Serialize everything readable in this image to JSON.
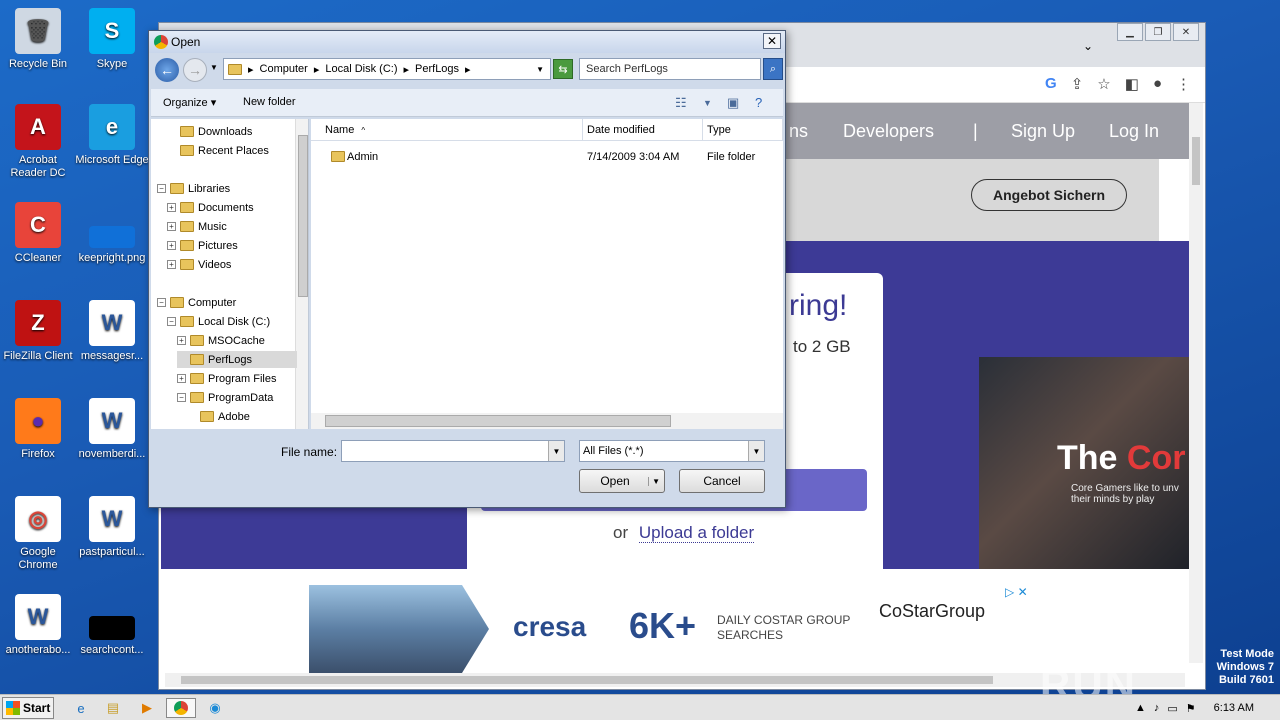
{
  "desktop_icons": [
    {
      "label": "Recycle Bin",
      "icon": "recycle-bin-icon"
    },
    {
      "label": "Skype",
      "icon": "skype-icon"
    },
    {
      "label": "Acrobat Reader DC",
      "icon": "acrobat-icon"
    },
    {
      "label": "Microsoft Edge",
      "icon": "edge-icon"
    },
    {
      "label": "CCleaner",
      "icon": "ccleaner-icon"
    },
    {
      "label": "keepright.png",
      "icon": "image-file-icon"
    },
    {
      "label": "FileZilla Client",
      "icon": "filezilla-icon"
    },
    {
      "label": "messagesr...",
      "icon": "word-doc-icon"
    },
    {
      "label": "Firefox",
      "icon": "firefox-icon"
    },
    {
      "label": "novemberdi...",
      "icon": "word-doc-icon"
    },
    {
      "label": "Google Chrome",
      "icon": "chrome-icon"
    },
    {
      "label": "pastparticul...",
      "icon": "word-doc-icon"
    },
    {
      "label": "anotherabo...",
      "icon": "word-doc-icon"
    },
    {
      "label": "searchcont...",
      "icon": "black-file-icon"
    }
  ],
  "browser": {
    "nav": [
      "ns",
      "Developers",
      "|",
      "Sign Up",
      "Log In"
    ],
    "angebot_button": "Angebot Sichern",
    "card_title": "ring!",
    "card_sub": "to 2 GB",
    "or_text": "or",
    "upload_folder": "Upload a folder",
    "promo_title_white": "The ",
    "promo_title_red": "Cor",
    "promo_sub": "Core Gamers like to unv their minds by play",
    "ad": {
      "brand": "cresa",
      "big": "6K+",
      "line1": "DAILY COSTAR GROUP",
      "line2": "SEARCHES",
      "costar": "CoStarGroup",
      "close": "▷ ✕"
    }
  },
  "dialog": {
    "title": "Open",
    "close": "✕",
    "breadcrumb": [
      "Computer",
      "Local Disk (C:)",
      "PerfLogs"
    ],
    "search_placeholder": "Search PerfLogs",
    "toolbar": {
      "organize": "Organize ▾",
      "new_folder": "New folder"
    },
    "tree": [
      {
        "label": "Downloads",
        "indent": 1
      },
      {
        "label": "Recent Places",
        "indent": 1
      },
      {
        "label": "Libraries",
        "indent": 0,
        "exp": "−"
      },
      {
        "label": "Documents",
        "indent": 1,
        "exp": "+"
      },
      {
        "label": "Music",
        "indent": 1,
        "exp": "+"
      },
      {
        "label": "Pictures",
        "indent": 1,
        "exp": "+"
      },
      {
        "label": "Videos",
        "indent": 1,
        "exp": "+"
      },
      {
        "label": "Computer",
        "indent": 0,
        "exp": "−"
      },
      {
        "label": "Local Disk (C:)",
        "indent": 1,
        "exp": "−"
      },
      {
        "label": "MSOCache",
        "indent": 2,
        "exp": "+"
      },
      {
        "label": "PerfLogs",
        "indent": 2,
        "selected": true
      },
      {
        "label": "Program Files",
        "indent": 2,
        "exp": "+"
      },
      {
        "label": "ProgramData",
        "indent": 2,
        "exp": "−"
      },
      {
        "label": "Adobe",
        "indent": 3
      }
    ],
    "columns": [
      "Name",
      "Date modified",
      "Type"
    ],
    "files": [
      {
        "name": "Admin",
        "date": "7/14/2009 3:04 AM",
        "type": "File folder"
      }
    ],
    "filename_label": "File name:",
    "filename_value": "",
    "filetype": "All Files (*.*)",
    "open_button": "Open",
    "cancel_button": "Cancel"
  },
  "taskbar": {
    "start": "Start",
    "time": "6:13 AM"
  },
  "watermark": "ANY ▷ RUN",
  "os_info": [
    "Test Mode",
    "Windows 7",
    "Build 7601"
  ]
}
